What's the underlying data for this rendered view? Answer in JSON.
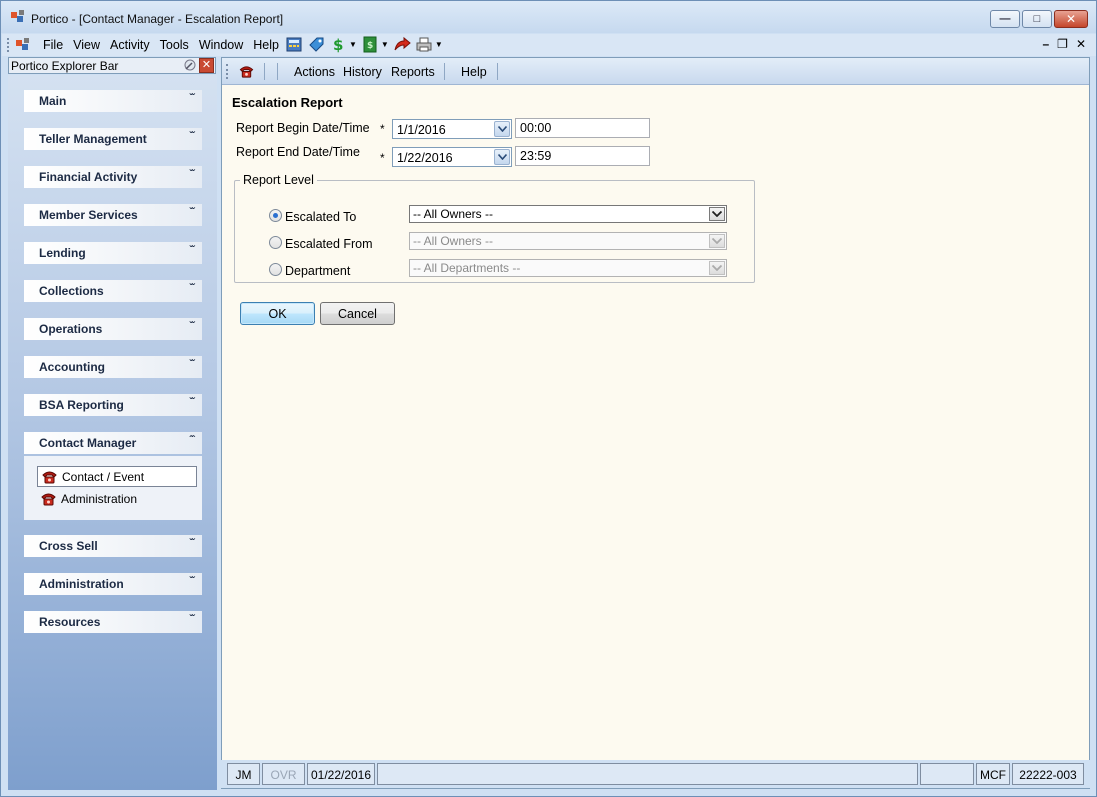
{
  "window": {
    "title": "Portico - [Contact Manager - Escalation Report]"
  },
  "menu": {
    "items": [
      "File",
      "View",
      "Activity",
      "Tools",
      "Window",
      "Help"
    ]
  },
  "explorer": {
    "title": "Portico Explorer Bar",
    "groups": [
      {
        "label": "Main",
        "expanded": false
      },
      {
        "label": "Teller Management",
        "expanded": false
      },
      {
        "label": "Financial Activity",
        "expanded": false
      },
      {
        "label": "Member Services",
        "expanded": false
      },
      {
        "label": "Lending",
        "expanded": false
      },
      {
        "label": "Collections",
        "expanded": false
      },
      {
        "label": "Operations",
        "expanded": false
      },
      {
        "label": "Accounting",
        "expanded": false
      },
      {
        "label": "BSA Reporting",
        "expanded": false
      },
      {
        "label": "Contact Manager",
        "expanded": true
      },
      {
        "label": "Cross Sell",
        "expanded": false
      },
      {
        "label": "Administration",
        "expanded": false
      },
      {
        "label": "Resources",
        "expanded": false
      }
    ],
    "contact_manager_items": [
      {
        "label": "Contact / Event",
        "selected": true
      },
      {
        "label": "Administration",
        "selected": false
      }
    ]
  },
  "toolbar": {
    "menus": [
      "Actions",
      "History",
      "Reports",
      "Help"
    ]
  },
  "report": {
    "title": "Escalation Report",
    "begin_label": "Report Begin Date/Time",
    "end_label": "Report End Date/Time",
    "required_mark": "*",
    "begin_date": "1/1/2016",
    "begin_time": "00:00",
    "end_date": "1/22/2016",
    "end_time": "23:59",
    "level_legend": "Report Level",
    "level_options": [
      {
        "label": "Escalated To",
        "checked": true,
        "value": "-- All Owners --",
        "enabled": true
      },
      {
        "label": "Escalated From",
        "checked": false,
        "value": "-- All Owners --",
        "enabled": false
      },
      {
        "label": "Department",
        "checked": false,
        "value": "-- All Departments --",
        "enabled": false
      }
    ],
    "ok_label": "OK",
    "cancel_label": "Cancel"
  },
  "status": {
    "user": "JM",
    "ovr": "OVR",
    "date": "01/22/2016",
    "mcf": "MCF",
    "code": "22222-003"
  }
}
